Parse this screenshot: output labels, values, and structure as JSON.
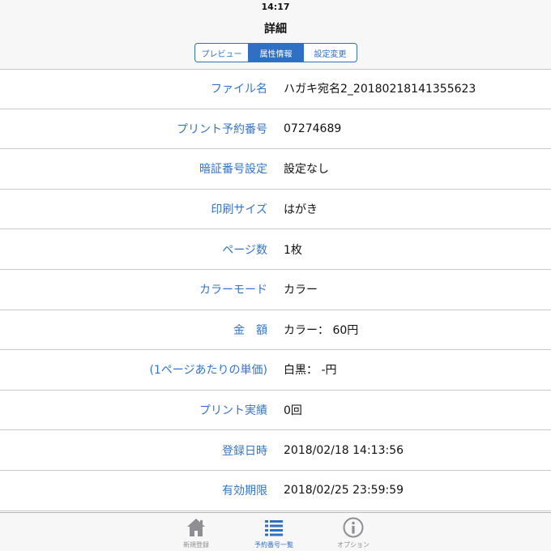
{
  "status_bar": {
    "time": "14:17"
  },
  "nav": {
    "title": "詳細",
    "segments": [
      {
        "label": "プレビュー",
        "selected": false
      },
      {
        "label": "属性情報",
        "selected": true
      },
      {
        "label": "設定変更",
        "selected": false
      }
    ]
  },
  "details": [
    {
      "label": "ファイル名",
      "value": "ハガキ宛名2_20180218141355623"
    },
    {
      "label": "プリント予約番号",
      "value": "07274689"
    },
    {
      "label": "暗証番号設定",
      "value": "設定なし"
    },
    {
      "label": "印刷サイズ",
      "value": "はがき"
    },
    {
      "label": "ページ数",
      "value": "1枚"
    },
    {
      "label": "カラーモード",
      "value": "カラー"
    },
    {
      "label": "金　額",
      "value": "カラー：  60円"
    },
    {
      "label": "(1ページあたりの単価)",
      "value": "白黒：  -円"
    },
    {
      "label": "プリント実績",
      "value": "0回"
    },
    {
      "label": "登録日時",
      "value": "2018/02/18 14:13:56"
    },
    {
      "label": "有効期限",
      "value": "2018/02/25 23:59:59"
    }
  ],
  "tabbar": [
    {
      "label": "新規登録",
      "icon": "house-icon",
      "selected": false
    },
    {
      "label": "予約番号一覧",
      "icon": "list-icon",
      "selected": true
    },
    {
      "label": "オプション",
      "icon": "info-icon",
      "selected": false
    }
  ],
  "colors": {
    "accent": "#2f6fc4",
    "label": "#3574c7",
    "separator": "#c8c8cc",
    "tab_inactive": "#8e8e93"
  }
}
